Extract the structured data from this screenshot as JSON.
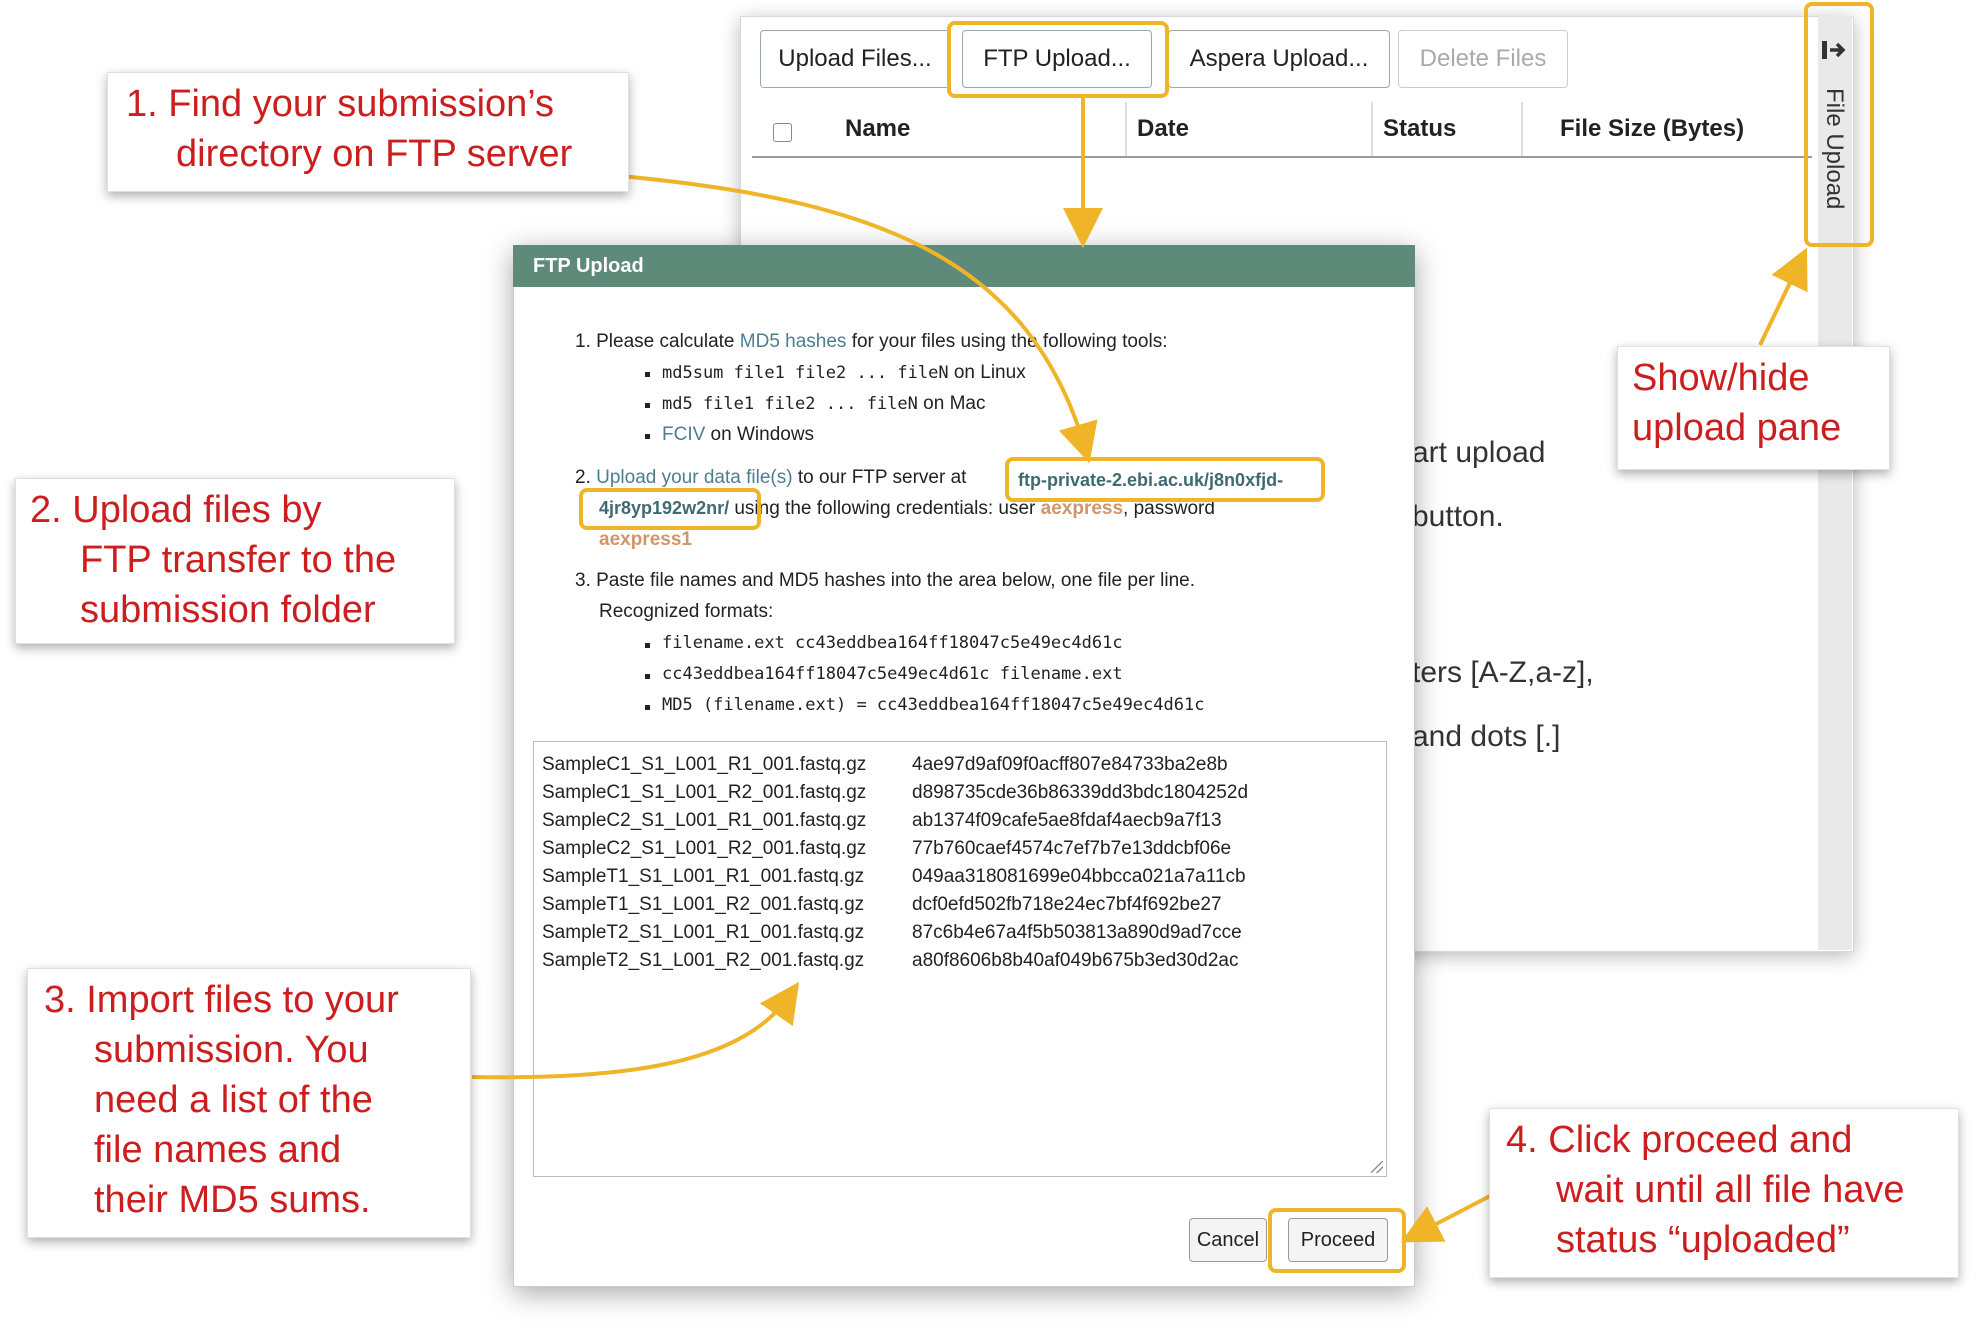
{
  "toolbar": {
    "upload_files": "Upload Files...",
    "ftp_upload": "FTP Upload...",
    "aspera_upload": "Aspera Upload...",
    "delete_files": "Delete Files"
  },
  "table": {
    "columns": [
      "Name",
      "Date",
      "Status",
      "File Size (Bytes)"
    ]
  },
  "side_pane": {
    "label": "File Upload",
    "icon": "sign-out-icon"
  },
  "background_text": {
    "line1": "art upload",
    "line2": "button.",
    "line3": "ters [A-Z,a-z],",
    "line4": "and dots [.]"
  },
  "modal": {
    "title": "FTP Upload",
    "step1": {
      "prefix": "1. Please calculate ",
      "link": "MD5 hashes",
      "suffix": " for your files using the following tools:",
      "tools": [
        {
          "cmd": "md5sum file1 file2 ... fileN",
          "os": " on Linux"
        },
        {
          "cmd": "md5 file1 file2 ... fileN",
          "os": " on Mac"
        },
        {
          "cmd": "FCIV",
          "os": " on Windows"
        }
      ]
    },
    "step2": {
      "prefix": "2. ",
      "link": "Upload your data file(s)",
      "middle": " to our FTP server at ",
      "server_part1": "ftp-private-2.ebi.ac.uk/j8n0xfjd-",
      "server_part2": "4jr8yp192w2nr/",
      "creds_text": " using the following credentials: user ",
      "user": "aexpress",
      "password_label": ", password",
      "password": "aexpress1"
    },
    "step3": {
      "line1": "3. Paste file names and MD5 hashes into the area below, one file per line.",
      "line2": "Recognized formats:",
      "formats": [
        "filename.ext cc43eddbea164ff18047c5e49ec4d61c",
        "cc43eddbea164ff18047c5e49ec4d61c filename.ext",
        "MD5 (filename.ext) = cc43eddbea164ff18047c5e49ec4d61c"
      ]
    },
    "files": [
      {
        "name": "SampleC1_S1_L001_R1_001.fastq.gz",
        "md5": "4ae97d9af09f0acff807e84733ba2e8b"
      },
      {
        "name": "SampleC1_S1_L001_R2_001.fastq.gz",
        "md5": "d898735cde36b86339dd3bdc1804252d"
      },
      {
        "name": "SampleC2_S1_L001_R1_001.fastq.gz",
        "md5": "ab1374f09cafe5ae8fdaf4aecb9a7f13"
      },
      {
        "name": "SampleC2_S1_L001_R2_001.fastq.gz",
        "md5": "77b760caef4574c7ef7b7e13ddcbf06e"
      },
      {
        "name": "SampleT1_S1_L001_R1_001.fastq.gz",
        "md5": "049aa318081699e04bbcca021a7a11cb"
      },
      {
        "name": "SampleT1_S1_L001_R2_001.fastq.gz",
        "md5": "dcf0efd502fb718e24ec7bf4f692be27"
      },
      {
        "name": "SampleT2_S1_L001_R1_001.fastq.gz",
        "md5": "87c6b4e67a4f5b503813a890d9ad7cce"
      },
      {
        "name": "SampleT2_S1_L001_R2_001.fastq.gz",
        "md5": "a80f8606b8b40af049b675b3ed30d2ac"
      }
    ],
    "cancel": "Cancel",
    "proceed": "Proceed"
  },
  "callouts": {
    "c1": [
      "1. Find your submission’s",
      "directory on FTP server"
    ],
    "c2": [
      "2. Upload files by",
      "FTP transfer to the",
      "submission folder"
    ],
    "c3": [
      "3. Import files to your",
      "submission. You",
      "need a list of the",
      "file names and",
      "their MD5 sums."
    ],
    "c4": [
      "4. Click proceed and",
      "wait until all file have",
      "status “uploaded”"
    ],
    "c5": [
      "Show/hide",
      "upload pane"
    ]
  },
  "colors": {
    "accent_yellow": "#f0b429",
    "callout_red": "#cc1e1e",
    "modal_header": "#5e8a7a"
  }
}
